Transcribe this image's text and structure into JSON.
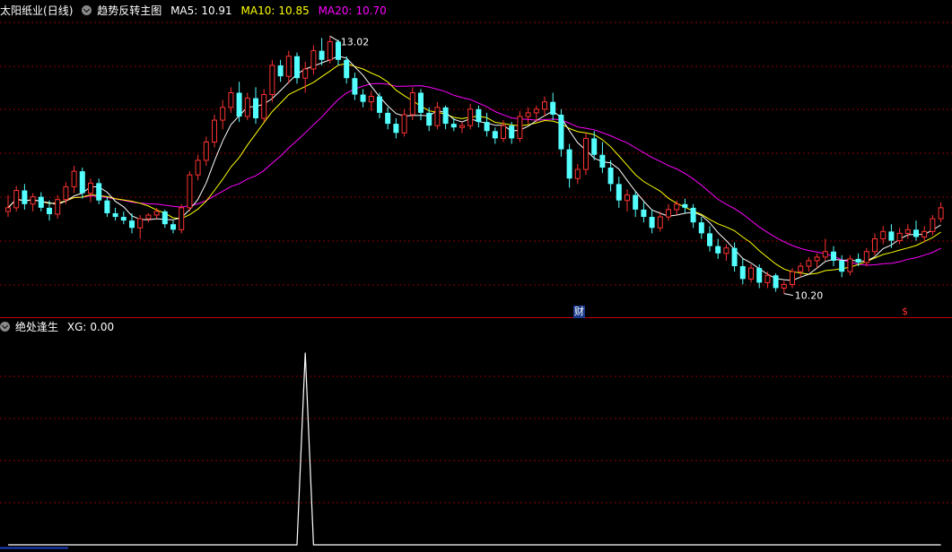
{
  "main_panel": {
    "stock_name": "太阳纸业",
    "period": "(日线)",
    "indicator_name": "趋势反转主图",
    "ma5_label": "MA5:",
    "ma5_value": "10.91",
    "ma10_label": "MA10:",
    "ma10_value": "10.85",
    "ma20_label": "MA20:",
    "ma20_value": "10.70",
    "high_label": "13.02",
    "low_label": "10.20",
    "finance_badge": "财",
    "dividend_badge": "$"
  },
  "sub_panel": {
    "indicator_name": "绝处逢生",
    "xg_label": "XG:",
    "xg_value": "0.00"
  },
  "colors": {
    "up": "#ff3232",
    "down": "#54ffff",
    "ma5": "#ffffff",
    "ma10": "#ffff00",
    "ma20": "#ff00ff",
    "grid": "#8b0000",
    "separator": "#c00000",
    "signal": "#ffffff"
  },
  "chart_data": {
    "type": "candlestick",
    "price_range": [
      10.0,
      13.2
    ],
    "candles": [
      [
        11.1,
        11.28,
        11.04,
        11.14
      ],
      [
        11.14,
        11.38,
        11.1,
        11.33
      ],
      [
        11.33,
        11.4,
        11.12,
        11.18
      ],
      [
        11.18,
        11.3,
        11.1,
        11.26
      ],
      [
        11.26,
        11.31,
        11.1,
        11.14
      ],
      [
        11.14,
        11.22,
        11.0,
        11.07
      ],
      [
        11.07,
        11.28,
        11.02,
        11.23
      ],
      [
        11.23,
        11.42,
        11.18,
        11.37
      ],
      [
        11.37,
        11.6,
        11.3,
        11.54
      ],
      [
        11.54,
        11.58,
        11.24,
        11.3
      ],
      [
        11.3,
        11.46,
        11.2,
        11.41
      ],
      [
        11.41,
        11.46,
        11.18,
        11.22
      ],
      [
        11.22,
        11.26,
        11.04,
        11.08
      ],
      [
        11.08,
        11.14,
        11.0,
        11.04
      ],
      [
        11.04,
        11.1,
        10.96,
        11.0
      ],
      [
        11.0,
        11.08,
        10.86,
        10.92
      ],
      [
        10.92,
        11.06,
        10.8,
        11.02
      ],
      [
        11.02,
        11.08,
        10.98,
        11.06
      ],
      [
        11.06,
        11.14,
        11.02,
        11.1
      ],
      [
        11.1,
        11.12,
        10.92,
        10.96
      ],
      [
        10.96,
        11.0,
        10.86,
        10.9
      ],
      [
        10.9,
        11.18,
        10.86,
        11.14
      ],
      [
        11.14,
        11.54,
        11.1,
        11.5
      ],
      [
        11.5,
        11.72,
        11.44,
        11.66
      ],
      [
        11.66,
        11.92,
        11.6,
        11.86
      ],
      [
        11.86,
        12.16,
        11.8,
        12.1
      ],
      [
        12.1,
        12.32,
        12.0,
        12.24
      ],
      [
        12.24,
        12.46,
        12.18,
        12.4
      ],
      [
        12.4,
        12.52,
        12.08,
        12.14
      ],
      [
        12.14,
        12.4,
        12.1,
        12.34
      ],
      [
        12.34,
        12.46,
        12.06,
        12.12
      ],
      [
        12.12,
        12.44,
        12.08,
        12.38
      ],
      [
        12.38,
        12.76,
        12.3,
        12.7
      ],
      [
        12.7,
        12.76,
        12.52,
        12.58
      ],
      [
        12.58,
        12.86,
        12.5,
        12.8
      ],
      [
        12.8,
        12.84,
        12.5,
        12.56
      ],
      [
        12.56,
        12.74,
        12.4,
        12.66
      ],
      [
        12.66,
        12.92,
        12.6,
        12.86
      ],
      [
        12.86,
        13.0,
        12.7,
        12.76
      ],
      [
        12.76,
        13.02,
        12.72,
        12.96
      ],
      [
        12.96,
        12.98,
        12.7,
        12.76
      ],
      [
        12.76,
        12.8,
        12.5,
        12.56
      ],
      [
        12.56,
        12.62,
        12.32,
        12.38
      ],
      [
        12.38,
        12.44,
        12.24,
        12.3
      ],
      [
        12.3,
        12.42,
        12.2,
        12.36
      ],
      [
        12.36,
        12.4,
        12.12,
        12.18
      ],
      [
        12.18,
        12.24,
        12.0,
        12.06
      ],
      [
        12.06,
        12.12,
        11.9,
        11.96
      ],
      [
        11.96,
        12.22,
        11.92,
        12.16
      ],
      [
        12.16,
        12.46,
        12.1,
        12.4
      ],
      [
        12.4,
        12.44,
        12.1,
        12.18
      ],
      [
        12.18,
        12.24,
        11.98,
        12.04
      ],
      [
        12.04,
        12.3,
        12.0,
        12.24
      ],
      [
        12.24,
        12.26,
        12.0,
        12.06
      ],
      [
        12.06,
        12.12,
        11.98,
        12.02
      ],
      [
        12.02,
        12.08,
        11.96,
        12.04
      ],
      [
        12.04,
        12.28,
        12.0,
        12.22
      ],
      [
        12.22,
        12.26,
        12.02,
        12.08
      ],
      [
        12.08,
        12.18,
        11.92,
        11.98
      ],
      [
        11.98,
        12.02,
        11.84,
        11.9
      ],
      [
        11.9,
        12.1,
        11.86,
        12.04
      ],
      [
        12.04,
        12.08,
        11.84,
        11.9
      ],
      [
        11.9,
        12.2,
        11.86,
        12.14
      ],
      [
        12.14,
        12.24,
        12.06,
        12.18
      ],
      [
        12.18,
        12.26,
        12.08,
        12.22
      ],
      [
        12.22,
        12.36,
        12.14,
        12.3
      ],
      [
        12.3,
        12.4,
        12.1,
        12.16
      ],
      [
        12.16,
        12.22,
        11.7,
        11.78
      ],
      [
        11.78,
        11.84,
        11.36,
        11.46
      ],
      [
        11.46,
        11.62,
        11.4,
        11.56
      ],
      [
        11.56,
        11.96,
        11.5,
        11.9
      ],
      [
        11.9,
        11.98,
        11.66,
        11.72
      ],
      [
        11.72,
        11.86,
        11.52,
        11.58
      ],
      [
        11.58,
        11.66,
        11.32,
        11.4
      ],
      [
        11.4,
        11.48,
        11.14,
        11.22
      ],
      [
        11.22,
        11.34,
        11.1,
        11.28
      ],
      [
        11.28,
        11.32,
        11.04,
        11.12
      ],
      [
        11.12,
        11.2,
        10.98,
        11.04
      ],
      [
        11.04,
        11.12,
        10.86,
        10.92
      ],
      [
        10.92,
        11.1,
        10.88,
        11.04
      ],
      [
        11.04,
        11.18,
        11.0,
        11.12
      ],
      [
        11.12,
        11.22,
        11.06,
        11.18
      ],
      [
        11.18,
        11.24,
        11.08,
        11.14
      ],
      [
        11.14,
        11.18,
        10.92,
        10.98
      ],
      [
        10.98,
        11.04,
        10.8,
        10.86
      ],
      [
        10.86,
        10.94,
        10.66,
        10.72
      ],
      [
        10.72,
        10.8,
        10.58,
        10.64
      ],
      [
        10.64,
        10.74,
        10.56,
        10.7
      ],
      [
        10.7,
        10.76,
        10.44,
        10.5
      ],
      [
        10.5,
        10.58,
        10.3,
        10.36
      ],
      [
        10.36,
        10.52,
        10.32,
        10.48
      ],
      [
        10.48,
        10.52,
        10.26,
        10.32
      ],
      [
        10.32,
        10.44,
        10.26,
        10.4
      ],
      [
        10.4,
        10.42,
        10.22,
        10.26
      ],
      [
        10.26,
        10.34,
        10.2,
        10.3
      ],
      [
        10.3,
        10.48,
        10.26,
        10.44
      ],
      [
        10.44,
        10.54,
        10.38,
        10.5
      ],
      [
        10.5,
        10.6,
        10.44,
        10.56
      ],
      [
        10.56,
        10.64,
        10.48,
        10.6
      ],
      [
        10.6,
        10.8,
        10.56,
        10.66
      ],
      [
        10.66,
        10.72,
        10.5,
        10.56
      ],
      [
        10.56,
        10.62,
        10.38,
        10.44
      ],
      [
        10.44,
        10.62,
        10.4,
        10.58
      ],
      [
        10.58,
        10.64,
        10.5,
        10.54
      ],
      [
        10.54,
        10.7,
        10.5,
        10.66
      ],
      [
        10.66,
        10.86,
        10.62,
        10.8
      ],
      [
        10.8,
        10.94,
        10.74,
        10.88
      ],
      [
        10.88,
        10.96,
        10.7,
        10.78
      ],
      [
        10.78,
        10.92,
        10.74,
        10.86
      ],
      [
        10.86,
        10.96,
        10.8,
        10.9
      ],
      [
        10.9,
        11.0,
        10.78,
        10.82
      ],
      [
        10.82,
        10.94,
        10.76,
        10.88
      ],
      [
        10.88,
        11.06,
        10.84,
        11.02
      ],
      [
        11.02,
        11.2,
        10.98,
        11.14
      ]
    ],
    "signal_spike_index": 36,
    "signal_value": 1,
    "xg_range": [
      0,
      1.1
    ]
  }
}
